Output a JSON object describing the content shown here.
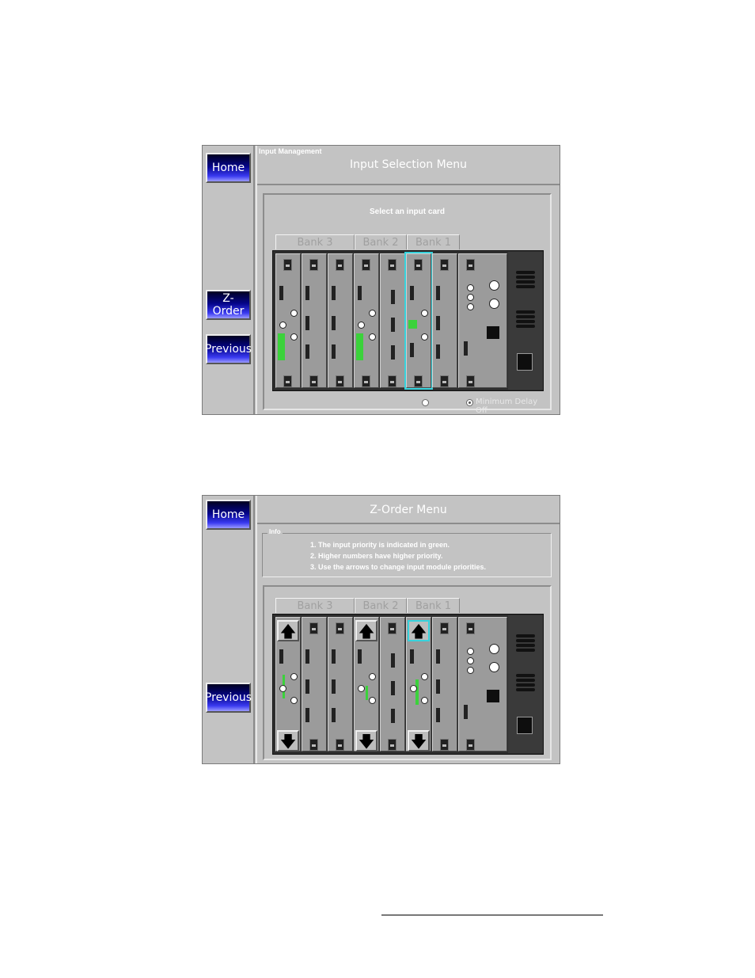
{
  "screen1": {
    "nav": {
      "home": "Home",
      "zorder": "Z-Order",
      "previous": "Previous"
    },
    "breadcrumb": "Input Management",
    "title": "Input Selection Menu",
    "prompt": "Select an input card",
    "banks": [
      "Bank 3",
      "Bank 2",
      "Bank 1"
    ],
    "selected_bank": "Bank 1",
    "options": {
      "option_1": "",
      "option_2": "Minimum Delay Off",
      "option_2_selected": true
    }
  },
  "screen2": {
    "nav": {
      "home": "Home",
      "previous": "Previous"
    },
    "title": "Z-Order Menu",
    "info": {
      "legend": "Info",
      "lines": [
        "1. The input priority is indicated in green.",
        "2. Higher numbers have higher priority.",
        "3. Use the arrows to change input module priorities."
      ]
    },
    "banks": [
      "Bank 3",
      "Bank 2",
      "Bank 1"
    ],
    "selected_bank": "Bank 1"
  },
  "colors": {
    "background": "#c3c3c3",
    "button": "#05058a",
    "selection": "#37d2dc",
    "priority": "#3bd23b"
  }
}
